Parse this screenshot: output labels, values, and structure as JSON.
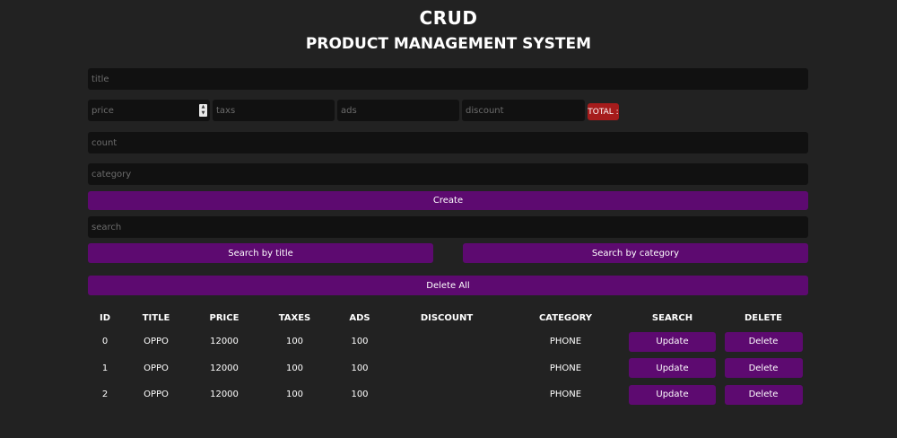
{
  "header": {
    "title": "CRUD",
    "subtitle": "PRODUCT MANAGEMENT SYSTEM"
  },
  "form": {
    "title_placeholder": "title",
    "price_placeholder": "price",
    "taxes_placeholder": "taxs",
    "ads_placeholder": "ads",
    "discount_placeholder": "discount",
    "total_label": "TOTAL :",
    "count_placeholder": "count",
    "category_placeholder": "category",
    "create_label": "Create"
  },
  "search": {
    "placeholder": "search",
    "by_title_label": "Search by title",
    "by_category_label": "Search by category",
    "delete_all_label": "Delete All"
  },
  "table": {
    "columns": [
      "ID",
      "TITLE",
      "PRICE",
      "TAXES",
      "ADS",
      "DISCOUNT",
      "CATEGORY",
      "SEARCH",
      "DELETE"
    ],
    "rows": [
      {
        "id": "0",
        "title": "OPPO",
        "price": "12000",
        "taxes": "100",
        "ads": "100",
        "discount": "",
        "category": "PHONE",
        "update": "Update",
        "delete": "Delete"
      },
      {
        "id": "1",
        "title": "OPPO",
        "price": "12000",
        "taxes": "100",
        "ads": "100",
        "discount": "",
        "category": "PHONE",
        "update": "Update",
        "delete": "Delete"
      },
      {
        "id": "2",
        "title": "OPPO",
        "price": "12000",
        "taxes": "100",
        "ads": "100",
        "discount": "",
        "category": "PHONE",
        "update": "Update",
        "delete": "Delete"
      }
    ]
  },
  "colors": {
    "background": "#222222",
    "input": "#111111",
    "button": "#5d0a70",
    "total": "#a61c1c"
  }
}
